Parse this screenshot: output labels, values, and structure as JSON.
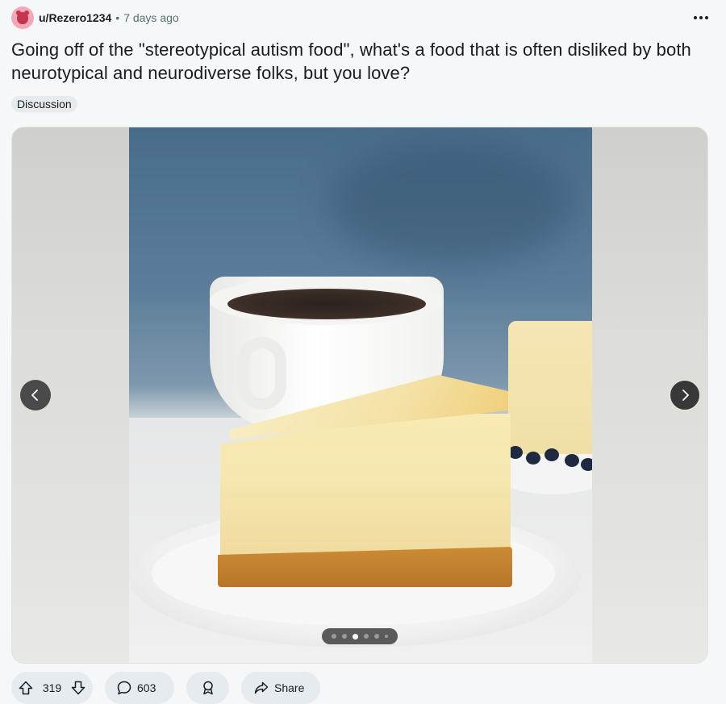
{
  "post": {
    "author": "u/Rezero1234",
    "separator": "•",
    "time": "7 days ago",
    "title": "Going off of the \"stereotypical autism food\", what's a food that is often disliked by both neurotypical and neurodiverse folks, but you love?",
    "flair": "Discussion"
  },
  "gallery": {
    "image_description": "cheesecake slice",
    "slide_count": 6,
    "active_slide": 3
  },
  "actions": {
    "upvotes": "319",
    "comments": "603",
    "share_label": "Share"
  },
  "icons": {
    "more": "more-horizontal-icon",
    "upvote": "arrow-up-icon",
    "downvote": "arrow-down-icon",
    "comment": "comment-bubble-icon",
    "award": "award-icon",
    "share": "share-arrow-icon",
    "prev": "chevron-left-icon",
    "next": "chevron-right-icon"
  },
  "colors": {
    "page_bg": "#f6f7f8",
    "pill_bg": "#e5ebee",
    "text": "#1c1c1c",
    "muted": "#576f76"
  }
}
